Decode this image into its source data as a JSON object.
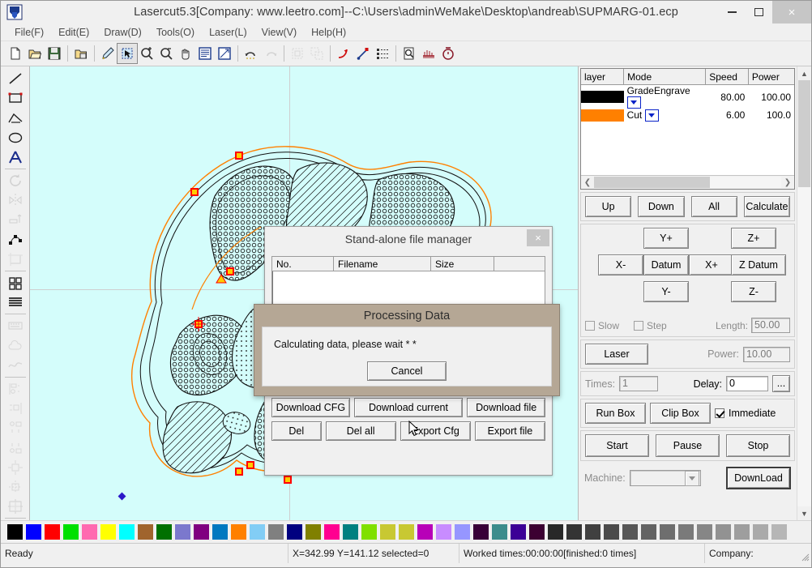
{
  "window": {
    "title": "Lasercut5.3[Company: www.leetro.com]--C:\\Users\\adminWeMake\\Desktop\\andreab\\SUPMARG-01.ecp",
    "app_icon": "lasercut-logo-icon",
    "minimize_label": "–",
    "maximize_label": "□",
    "close_label": "×"
  },
  "menu": {
    "items": [
      {
        "label": "File(F)",
        "name": "menu-file"
      },
      {
        "label": "Edit(E)",
        "name": "menu-edit"
      },
      {
        "label": "Draw(D)",
        "name": "menu-draw"
      },
      {
        "label": "Tools(O)",
        "name": "menu-tools"
      },
      {
        "label": "Laser(L)",
        "name": "menu-laser"
      },
      {
        "label": "View(V)",
        "name": "menu-view"
      },
      {
        "label": "Help(H)",
        "name": "menu-help"
      }
    ]
  },
  "toolbar": {
    "items": [
      {
        "name": "new-icon",
        "glyph": "new"
      },
      {
        "name": "open-icon",
        "glyph": "open"
      },
      {
        "name": "save-icon",
        "glyph": "save"
      },
      {
        "name": "import-icon",
        "glyph": "import"
      },
      {
        "name": "pen-icon",
        "glyph": "pen"
      },
      {
        "name": "select-icon",
        "glyph": "select"
      },
      {
        "name": "zoom-in-icon",
        "glyph": "zoomin"
      },
      {
        "name": "zoom-out-icon",
        "glyph": "zoomout"
      },
      {
        "name": "pan-hand-icon",
        "glyph": "hand"
      },
      {
        "name": "fit-window-icon",
        "glyph": "fitwin"
      },
      {
        "name": "fit-selection-icon",
        "glyph": "fitsel"
      },
      {
        "name": "undo-icon",
        "glyph": "undo"
      },
      {
        "name": "redo-icon",
        "glyph": "redo"
      },
      {
        "name": "group-icon",
        "glyph": "group"
      },
      {
        "name": "ungroup-icon",
        "glyph": "ungroup"
      },
      {
        "name": "arrow-path-icon",
        "glyph": "arrowpath"
      },
      {
        "name": "node-arrow-icon",
        "glyph": "nodearrow"
      },
      {
        "name": "order-icon",
        "glyph": "order"
      },
      {
        "name": "preview-icon",
        "glyph": "preview"
      },
      {
        "name": "cut-order-icon",
        "glyph": "cutorder"
      },
      {
        "name": "timer-icon",
        "glyph": "timer"
      }
    ]
  },
  "lefttools": {
    "items": [
      {
        "name": "tool-line",
        "glyph": "line",
        "disabled": false
      },
      {
        "name": "tool-rectangle",
        "glyph": "rect",
        "disabled": false
      },
      {
        "name": "tool-polyline",
        "glyph": "polyline",
        "disabled": false
      },
      {
        "name": "tool-ellipse",
        "glyph": "ellipse",
        "disabled": false
      },
      {
        "name": "tool-text",
        "glyph": "text",
        "disabled": false
      },
      {
        "name": "tool-rotate",
        "glyph": "rotate",
        "disabled": true
      },
      {
        "name": "tool-mirror",
        "glyph": "mirror",
        "disabled": true
      },
      {
        "name": "tool-align-arrange",
        "glyph": "arrange",
        "disabled": true
      },
      {
        "name": "tool-node-edit",
        "glyph": "nodeedit",
        "disabled": false
      },
      {
        "name": "tool-crop",
        "glyph": "crop",
        "disabled": true
      },
      {
        "name": "tool-array",
        "glyph": "array",
        "disabled": false
      },
      {
        "name": "tool-align-text",
        "glyph": "aligntext",
        "disabled": false
      },
      {
        "name": "tool-keyboard",
        "glyph": "keyboard",
        "disabled": true
      },
      {
        "name": "tool-cloud",
        "glyph": "cloud",
        "disabled": true
      },
      {
        "name": "tool-curve",
        "glyph": "curve",
        "disabled": true
      },
      {
        "name": "tool-align-left",
        "glyph": "alignleft",
        "disabled": true
      },
      {
        "name": "tool-align-right",
        "glyph": "alignright",
        "disabled": true
      },
      {
        "name": "tool-align-top",
        "glyph": "aligntop",
        "disabled": true
      },
      {
        "name": "tool-align-bottom",
        "glyph": "alignbottom",
        "disabled": true
      },
      {
        "name": "tool-center-horizontal",
        "glyph": "centerh",
        "disabled": true
      },
      {
        "name": "tool-center-vertical",
        "glyph": "centerv",
        "disabled": true
      },
      {
        "name": "tool-fit-frame",
        "glyph": "fitframe",
        "disabled": true
      }
    ]
  },
  "layers": {
    "columns": [
      "layer",
      "Mode",
      "Speed",
      "Power"
    ],
    "rows": [
      {
        "color": "#000000",
        "mode": "GradeEngrave",
        "speed": "80.00",
        "power": "100.00"
      },
      {
        "color": "#ff8000",
        "mode": "Cut",
        "speed": "6.00",
        "power": "100.0"
      }
    ]
  },
  "controls": {
    "order_buttons": [
      "Up",
      "Down",
      "All",
      "Calculate"
    ],
    "jog": {
      "y_plus": "Y+",
      "y_minus": "Y-",
      "x_plus": "X+",
      "x_minus": "X-",
      "datum": "Datum",
      "z_plus": "Z+",
      "z_minus": "Z-",
      "z_datum": "Z Datum",
      "slow_label": "Slow",
      "slow_checked": false,
      "step_label": "Step",
      "step_checked": false,
      "length_label": "Length:",
      "length_value": "50.00"
    },
    "laser": {
      "button": "Laser",
      "power_label": "Power:",
      "power_value": "10.00"
    },
    "run": {
      "times_label": "Times:",
      "times_value": "1",
      "delay_label": "Delay:",
      "delay_value": "0",
      "more_label": "...",
      "run_box": "Run Box",
      "clip_box": "Clip Box",
      "immediate_label": "Immediate",
      "immediate_checked": true,
      "start": "Start",
      "pause": "Pause",
      "stop": "Stop",
      "machine_label": "Machine:",
      "machine_value": "",
      "download": "DownLoad"
    }
  },
  "palette": {
    "colors": [
      "#000000",
      "#0000ff",
      "#ff0000",
      "#00e000",
      "#ff6ab0",
      "#ffff00",
      "#00ffff",
      "#a0642d",
      "#007000",
      "#7b78cd",
      "#800080",
      "#0078c0",
      "#ff8000",
      "#82cdf5",
      "#808080",
      "#000080",
      "#808000",
      "#ff0090",
      "#008080",
      "#80e000",
      "#c8c832",
      "#c8c832",
      "#b800b8",
      "#c88cff",
      "#9696ff",
      "#380038",
      "#3c8c8c",
      "#3c0096",
      "#3c0032",
      "#282828",
      "#343434",
      "#404040",
      "#4b4b4b",
      "#575757",
      "#636363",
      "#6e6e6e",
      "#7a7a7a",
      "#868686",
      "#929292",
      "#9e9e9e",
      "#aaaaaa",
      "#b6b6b6"
    ]
  },
  "statusbar": {
    "ready": "Ready",
    "coords": "X=342.99 Y=141.12 selected=0",
    "worked": "Worked times:00:00:00[finished:0 times]",
    "company": "Company:"
  },
  "filemanager": {
    "title": "Stand-alone file manager",
    "close_label": "×",
    "columns": [
      "No.",
      "Filename",
      "Size",
      ""
    ],
    "rows": [],
    "buttons_row1": [
      "Download CFG",
      "Download current",
      "Download file"
    ],
    "buttons_row2": [
      "Del",
      "Del all",
      "Export Cfg",
      "Export file"
    ]
  },
  "processing": {
    "title": "Processing Data",
    "message": "Calculating data, please wait * *",
    "cancel_label": "Cancel"
  }
}
